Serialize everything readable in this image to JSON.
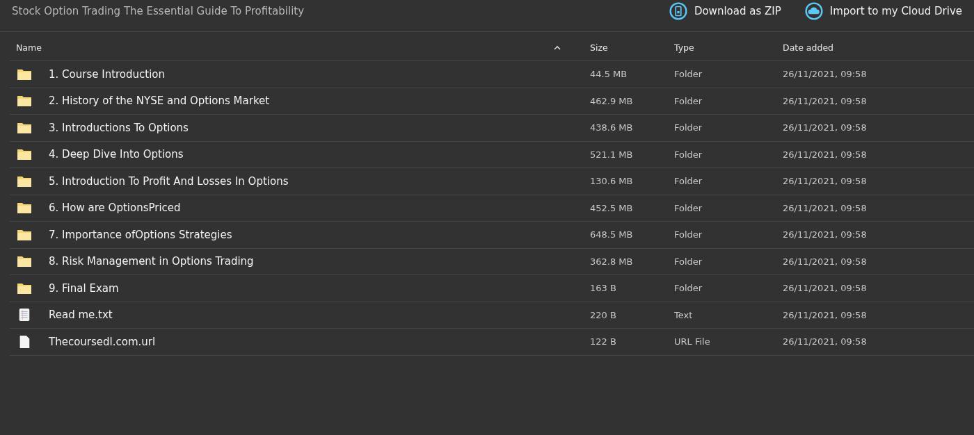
{
  "title": "Stock Option Trading The Essential Guide To Profitability",
  "actions": [
    {
      "kind": "zip",
      "label": "Download as ZIP"
    },
    {
      "kind": "cloud",
      "label": "Import to my Cloud Drive"
    }
  ],
  "columns": [
    {
      "label": "Name",
      "sorted": true
    },
    {
      "label": "Size",
      "sorted": false
    },
    {
      "label": "Type",
      "sorted": false
    },
    {
      "label": "Date added",
      "sorted": false
    }
  ],
  "rows": [
    {
      "kind": "folder",
      "name": "1. Course Introduction",
      "size": "44.5 MB",
      "type": "Folder",
      "date": "26/11/2021, 09:58"
    },
    {
      "kind": "folder",
      "name": "2. History of the NYSE and Options Market",
      "size": "462.9 MB",
      "type": "Folder",
      "date": "26/11/2021, 09:58"
    },
    {
      "kind": "folder",
      "name": "3. Introductions To Options",
      "size": "438.6 MB",
      "type": "Folder",
      "date": "26/11/2021, 09:58"
    },
    {
      "kind": "folder",
      "name": "4. Deep Dive Into Options",
      "size": "521.1 MB",
      "type": "Folder",
      "date": "26/11/2021, 09:58"
    },
    {
      "kind": "folder",
      "name": "5. Introduction To Profit And Losses In Options",
      "size": "130.6 MB",
      "type": "Folder",
      "date": "26/11/2021, 09:58"
    },
    {
      "kind": "folder",
      "name": "6. How are OptionsPriced",
      "size": "452.5 MB",
      "type": "Folder",
      "date": "26/11/2021, 09:58"
    },
    {
      "kind": "folder",
      "name": "7. Importance ofOptions Strategies",
      "size": "648.5 MB",
      "type": "Folder",
      "date": "26/11/2021, 09:58"
    },
    {
      "kind": "folder",
      "name": "8. Risk Management in Options Trading",
      "size": "362.8 MB",
      "type": "Folder",
      "date": "26/11/2021, 09:58"
    },
    {
      "kind": "folder",
      "name": "9. Final Exam",
      "size": "163 B",
      "type": "Folder",
      "date": "26/11/2021, 09:58"
    },
    {
      "kind": "text",
      "name": "Read me.txt",
      "size": "220 B",
      "type": "Text",
      "date": "26/11/2021, 09:58"
    },
    {
      "kind": "file",
      "name": "Thecoursedl.com.url",
      "size": "122 B",
      "type": "URL File",
      "date": "26/11/2021, 09:58"
    }
  ]
}
